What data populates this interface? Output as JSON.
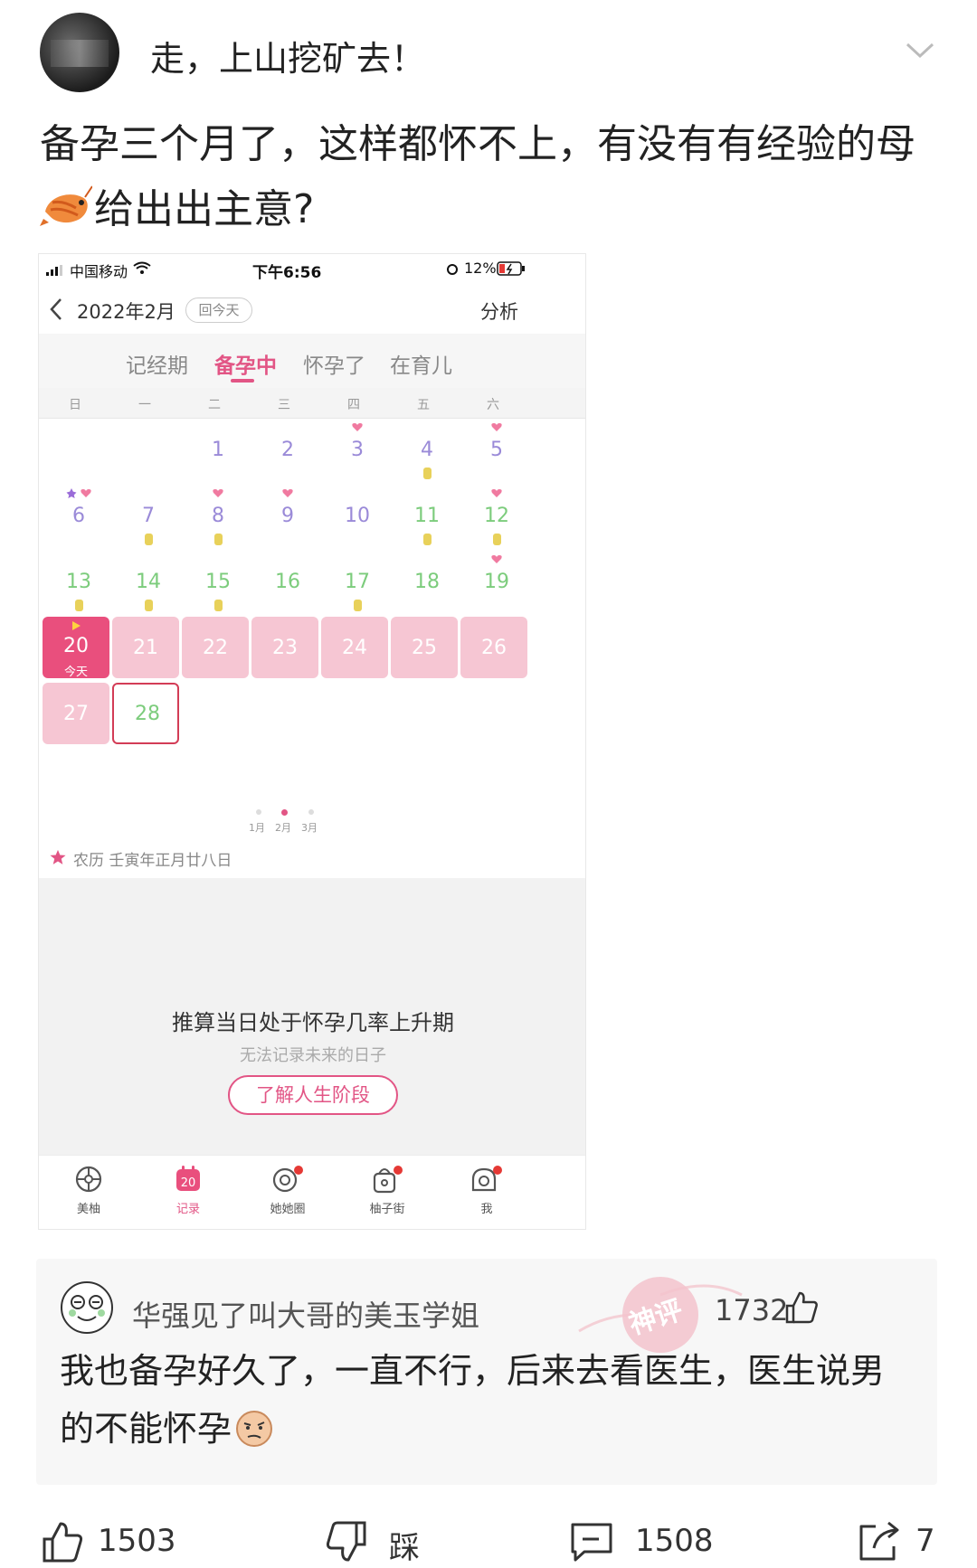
{
  "post": {
    "username": "走，上山挖矿去！",
    "text_line1": "备孕三个月了，这样都怀不上，有没有有经验的母",
    "text_line2": "给出出主意?"
  },
  "phone": {
    "status": {
      "carrier": "中国移动",
      "time": "下午6:56",
      "battery": "12%"
    },
    "header": {
      "month": "2022年2月",
      "today_btn": "回今天",
      "analysis": "分析"
    },
    "phase_tabs": [
      {
        "label": "记经期",
        "active": false
      },
      {
        "label": "备孕中",
        "active": true
      },
      {
        "label": "怀孕了",
        "active": false
      },
      {
        "label": "在育儿",
        "active": false
      }
    ],
    "weekdays": [
      "日",
      "一",
      "二",
      "三",
      "四",
      "五",
      "六"
    ],
    "calendar": [
      {
        "day": "1",
        "col": 2,
        "row": 0,
        "style": "purple"
      },
      {
        "day": "2",
        "col": 3,
        "row": 0,
        "style": "purple"
      },
      {
        "day": "3",
        "col": 4,
        "row": 0,
        "style": "purple",
        "heart": true
      },
      {
        "day": "4",
        "col": 5,
        "row": 0,
        "style": "purple",
        "coin": true
      },
      {
        "day": "5",
        "col": 6,
        "row": 0,
        "style": "purple",
        "heart": true
      },
      {
        "day": "6",
        "col": 0,
        "row": 1,
        "style": "purple",
        "heart": true,
        "flower": true
      },
      {
        "day": "7",
        "col": 1,
        "row": 1,
        "style": "purple",
        "coin": true
      },
      {
        "day": "8",
        "col": 2,
        "row": 1,
        "style": "purple",
        "heart": true,
        "coin": true
      },
      {
        "day": "9",
        "col": 3,
        "row": 1,
        "style": "purple",
        "heart": true
      },
      {
        "day": "10",
        "col": 4,
        "row": 1,
        "style": "purple"
      },
      {
        "day": "11",
        "col": 5,
        "row": 1,
        "style": "green",
        "coin": true
      },
      {
        "day": "12",
        "col": 6,
        "row": 1,
        "style": "green",
        "heart": true,
        "coin": true
      },
      {
        "day": "13",
        "col": 0,
        "row": 2,
        "style": "green",
        "coin": true
      },
      {
        "day": "14",
        "col": 1,
        "row": 2,
        "style": "green",
        "coin": true
      },
      {
        "day": "15",
        "col": 2,
        "row": 2,
        "style": "green",
        "coin": true
      },
      {
        "day": "16",
        "col": 3,
        "row": 2,
        "style": "green"
      },
      {
        "day": "17",
        "col": 4,
        "row": 2,
        "style": "green",
        "coin": true
      },
      {
        "day": "18",
        "col": 5,
        "row": 2,
        "style": "green"
      },
      {
        "day": "19",
        "col": 6,
        "row": 2,
        "style": "green",
        "heart": true
      },
      {
        "day": "20",
        "col": 0,
        "row": 3,
        "style": "today",
        "sub": "今天"
      },
      {
        "day": "21",
        "col": 1,
        "row": 3,
        "style": "pink"
      },
      {
        "day": "22",
        "col": 2,
        "row": 3,
        "style": "pink"
      },
      {
        "day": "23",
        "col": 3,
        "row": 3,
        "style": "pink"
      },
      {
        "day": "24",
        "col": 4,
        "row": 3,
        "style": "pink"
      },
      {
        "day": "25",
        "col": 5,
        "row": 3,
        "style": "pink"
      },
      {
        "day": "26",
        "col": 6,
        "row": 3,
        "style": "pink"
      },
      {
        "day": "27",
        "col": 0,
        "row": 4,
        "style": "pink"
      },
      {
        "day": "28",
        "col": 1,
        "row": 4,
        "style": "outlined"
      }
    ],
    "month_dots": [
      "1月",
      "2月",
      "3月"
    ],
    "lunar": "农历 壬寅年正月廿八日",
    "panel": {
      "title": "推算当日处于怀孕几率上升期",
      "subtitle": "无法记录未来的日子",
      "button": "了解人生阶段"
    },
    "tabbar": [
      {
        "label": "美柚",
        "icon": "meiyou-icon",
        "active": false
      },
      {
        "label": "记录",
        "icon": "calendar-icon",
        "active": true,
        "badge_num": "20"
      },
      {
        "label": "她她圈",
        "icon": "circle-icon",
        "active": false
      },
      {
        "label": "柚子街",
        "icon": "shop-bag-icon",
        "active": false
      },
      {
        "label": "我",
        "icon": "profile-icon",
        "active": false
      }
    ]
  },
  "comment": {
    "user": "华强见了叫大哥的美玉学姐",
    "stamp": "神评",
    "likes": "1732",
    "text_line1": "我也备孕好久了，一直不行，后来去看医生，医生说男",
    "text_line2": "的不能怀孕"
  },
  "actions": {
    "like_count": "1503",
    "dislike_label": "踩",
    "comment_count": "1508",
    "share_count": "7"
  },
  "colors": {
    "accent": "#e25585",
    "today": "#e94f7d",
    "pink_cell": "#f6c6d3",
    "green_num": "#7ccc7c",
    "purple_num": "#9a8ad8"
  }
}
